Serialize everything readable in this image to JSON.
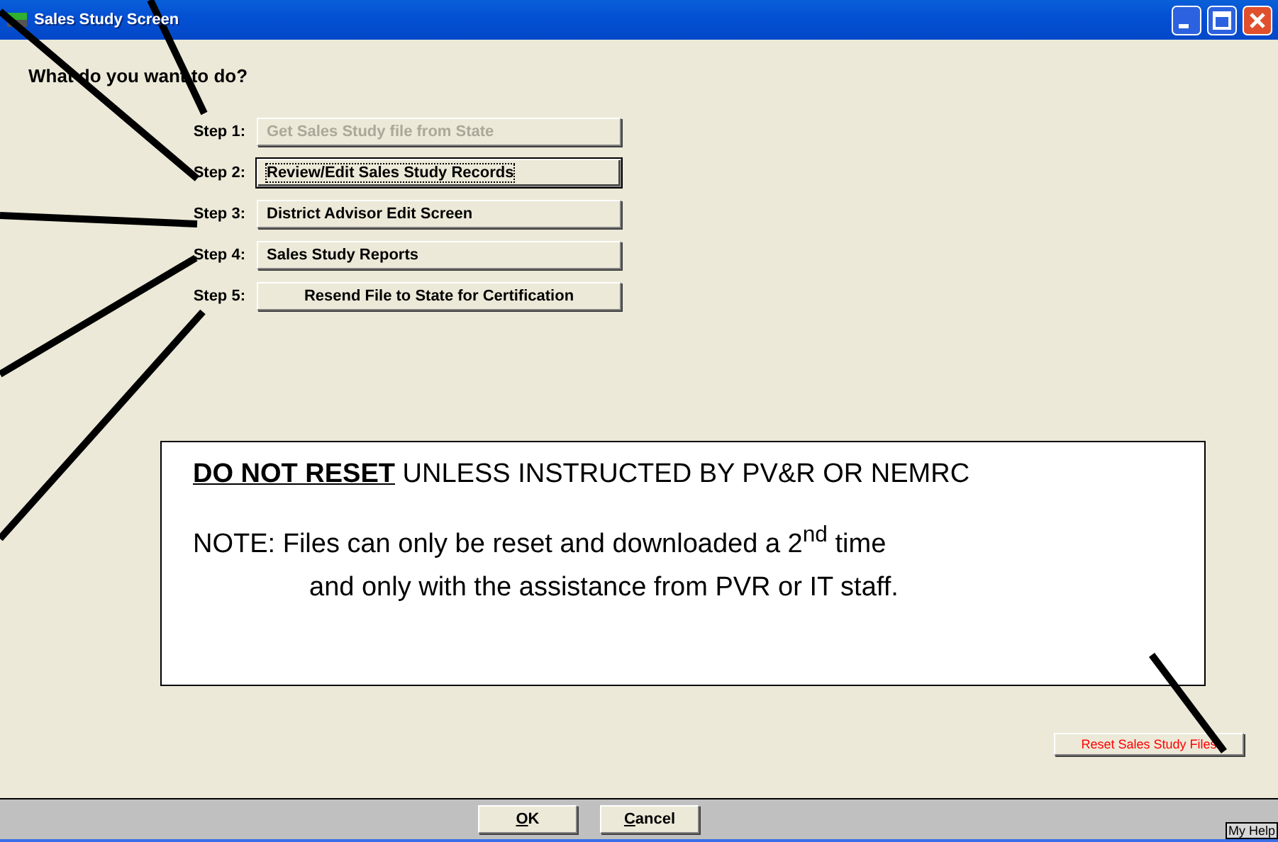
{
  "window": {
    "title": "Sales Study Screen"
  },
  "prompt": "What do you want to do?",
  "steps": [
    {
      "label": "Step 1:",
      "button": "Get Sales Study file from State",
      "disabled": true,
      "focused": false,
      "kind": "left"
    },
    {
      "label": "Step 2:",
      "button": "Review/Edit Sales Study Records",
      "disabled": false,
      "focused": true,
      "kind": "left"
    },
    {
      "label": "Step 3:",
      "button": "District Advisor Edit Screen",
      "disabled": false,
      "focused": false,
      "kind": "left"
    },
    {
      "label": "Step 4:",
      "button": "Sales Study Reports",
      "disabled": false,
      "focused": false,
      "kind": "left"
    },
    {
      "label": "Step 5:",
      "button": "Resend File to State for Certification",
      "disabled": false,
      "focused": false,
      "kind": "centered"
    }
  ],
  "note": {
    "warning": "**DO NOT RESET** UNLESS INSTRUCTED BY PV&R OR NEMRC",
    "lines": [
      "NOTE:  Files can only be reset and downloaded a 2$^{nd}$ time",
      "and only with the assistance from PVR or IT staff."
    ]
  },
  "reset_button": "Reset Sales Study Files",
  "footer": {
    "buttons": [
      {
        "label": "OK"
      },
      {
        "label": "Cancel"
      }
    ],
    "help": "My Help"
  }
}
